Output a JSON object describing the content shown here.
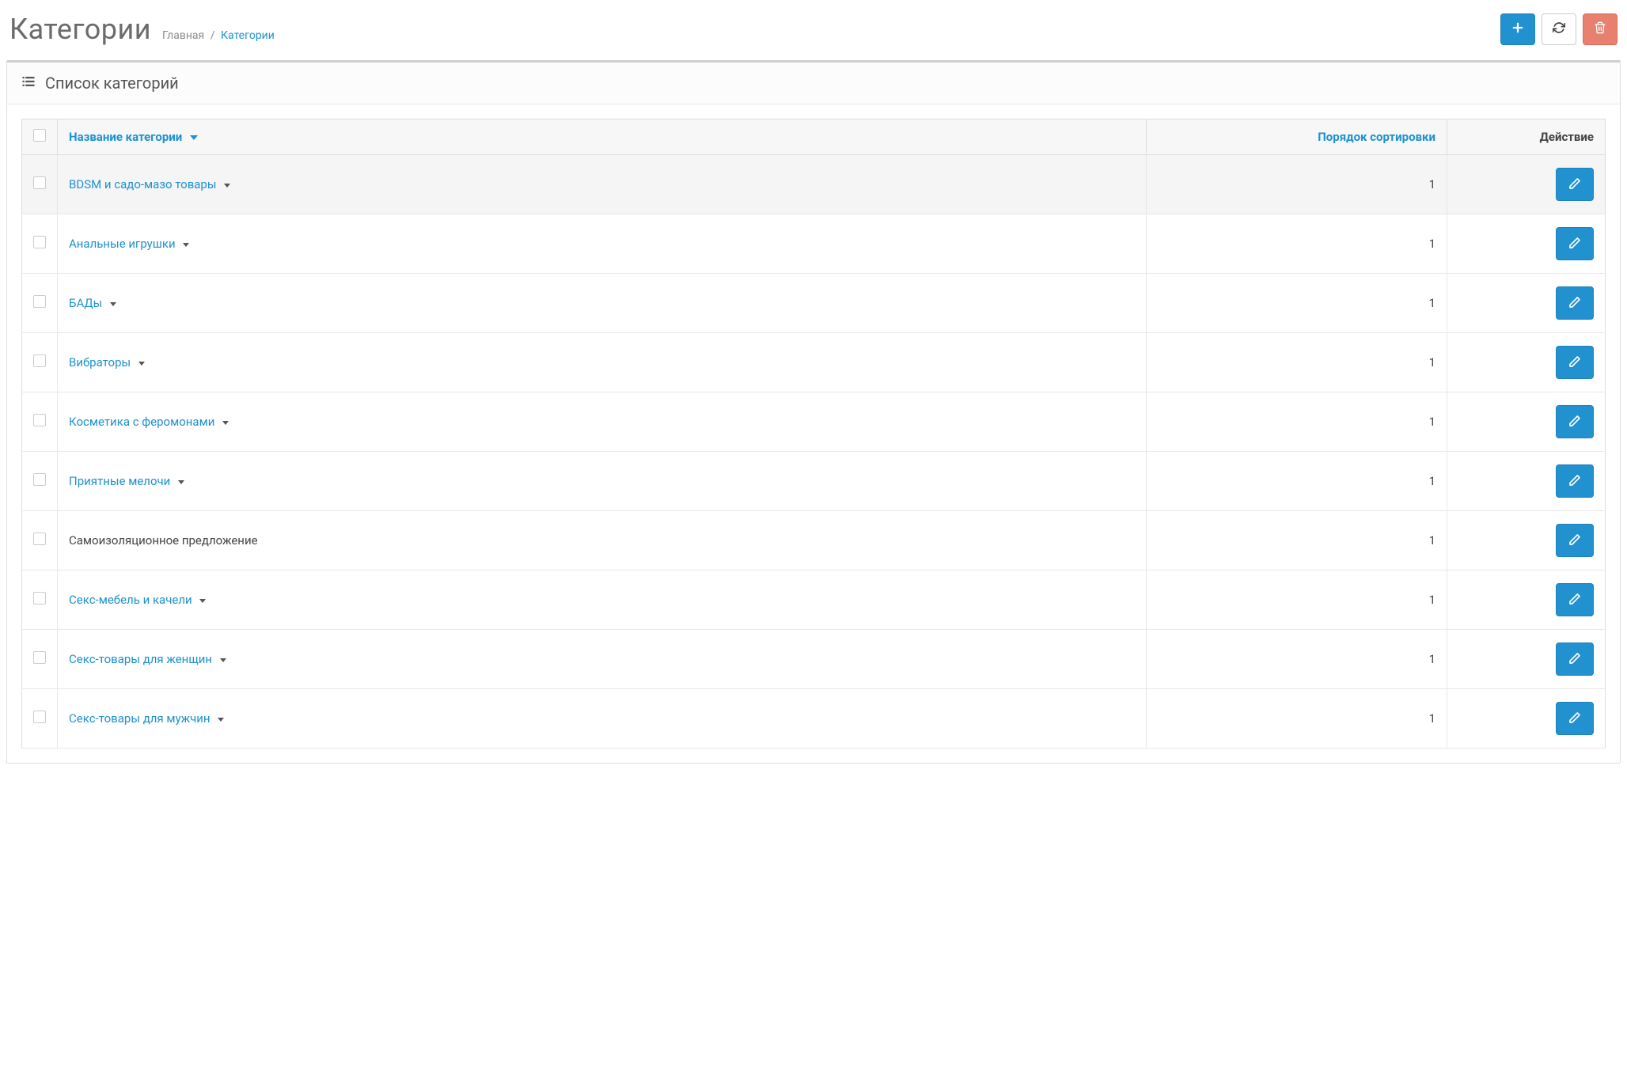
{
  "header": {
    "title": "Категории",
    "breadcrumb_home": "Главная",
    "breadcrumb_sep": "/",
    "breadcrumb_current": "Категории"
  },
  "panel": {
    "title": "Список категорий"
  },
  "table": {
    "col_name": "Название категории",
    "col_sort": "Порядок сортировки",
    "col_action": "Действие",
    "rows": [
      {
        "name": "BDSM и садо-мазо товары",
        "sort": "1",
        "highlight": true,
        "is_link": true,
        "has_caret": true
      },
      {
        "name": "Анальные игрушки",
        "sort": "1",
        "highlight": false,
        "is_link": true,
        "has_caret": true
      },
      {
        "name": "БАДы",
        "sort": "1",
        "highlight": false,
        "is_link": true,
        "has_caret": true
      },
      {
        "name": "Вибраторы",
        "sort": "1",
        "highlight": false,
        "is_link": true,
        "has_caret": true
      },
      {
        "name": "Косметика с феромонами",
        "sort": "1",
        "highlight": false,
        "is_link": true,
        "has_caret": true
      },
      {
        "name": "Приятные мелочи",
        "sort": "1",
        "highlight": false,
        "is_link": true,
        "has_caret": true
      },
      {
        "name": "Самоизоляционное предложение",
        "sort": "1",
        "highlight": false,
        "is_link": false,
        "has_caret": false
      },
      {
        "name": "Секс-мебель и качели",
        "sort": "1",
        "highlight": false,
        "is_link": true,
        "has_caret": true
      },
      {
        "name": "Секс-товары для женщин",
        "sort": "1",
        "highlight": false,
        "is_link": true,
        "has_caret": true
      },
      {
        "name": "Секс-товары для мужчин",
        "sort": "1",
        "highlight": false,
        "is_link": true,
        "has_caret": true
      }
    ]
  }
}
